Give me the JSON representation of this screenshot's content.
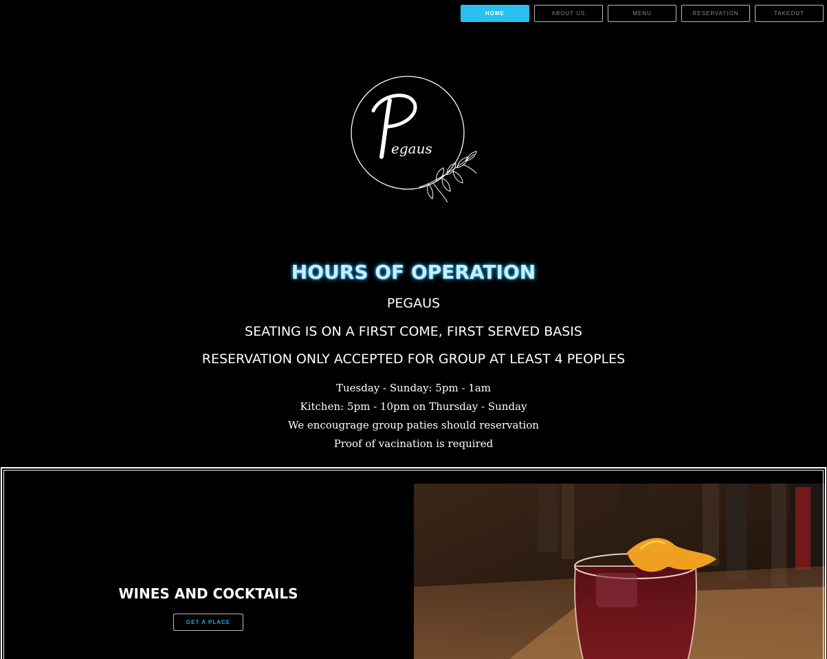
{
  "nav": {
    "items": [
      {
        "label": "HOME",
        "active": true
      },
      {
        "label": "ABOUT US",
        "active": false
      },
      {
        "label": "MENU",
        "active": false
      },
      {
        "label": "RESERVATION",
        "active": false
      },
      {
        "label": "TAKEOUT",
        "active": false
      }
    ]
  },
  "logo": {
    "text": "Pegaus",
    "icon": "leaf-branch-icon"
  },
  "hours": {
    "title": "HOURS OF OPERATION",
    "name": "PEGAUS",
    "notice1": "SEATING IS ON A FIRST COME, FIRST SERVED BASIS",
    "notice2": "RESERVATION ONLY ACCEPTED FOR GROUP AT LEAST 4 PEOPLES",
    "lines": [
      "Tuesday - Sunday: 5pm - 1am",
      "Kitchen: 5pm - 10pm on Thursday - Sunday",
      "We encougrage group paties should reservation",
      "Proof of vacination is required"
    ]
  },
  "feature": {
    "title": "WINES AND COCKTAILS",
    "button": "GET A PLACE",
    "image": "cocktail-glass-photo"
  },
  "colors": {
    "accent": "#29c0f0",
    "background": "#000000",
    "text": "#ffffff"
  }
}
